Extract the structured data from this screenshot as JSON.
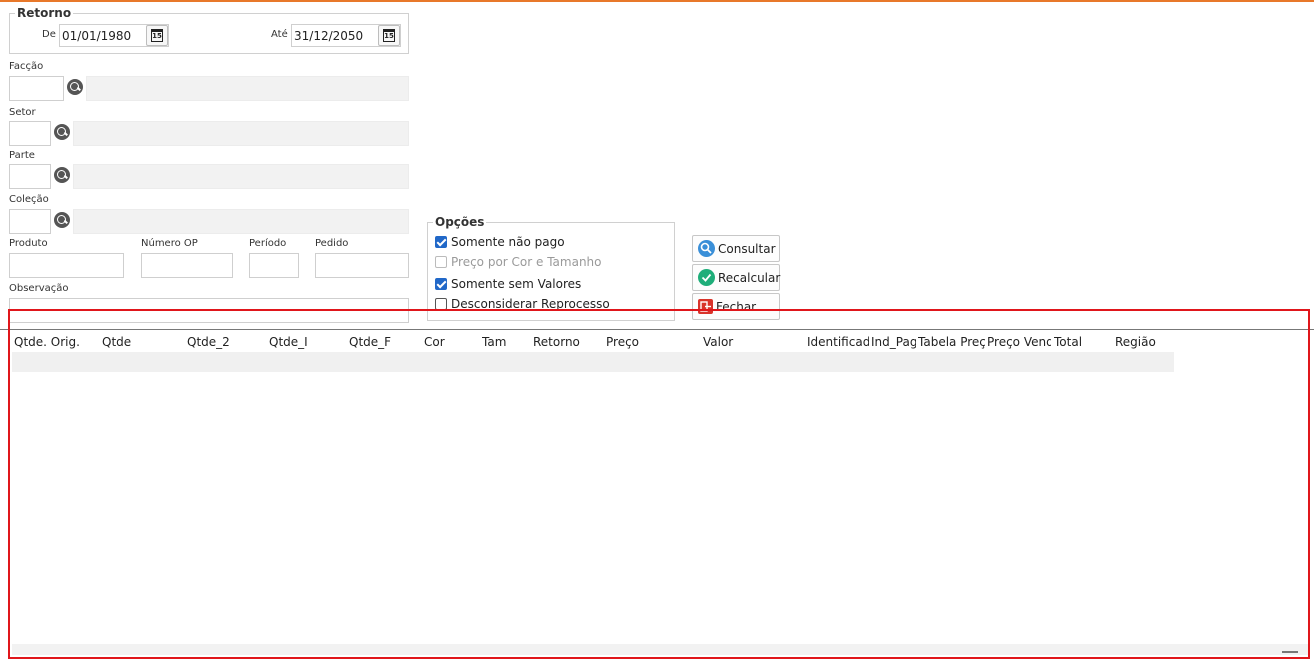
{
  "retorno": {
    "legend": "Retorno",
    "de_label": "De",
    "de_value": "01/01/1980",
    "ate_label": "Até",
    "ate_value": "31/12/2050",
    "cal_glyph": "15"
  },
  "faccao": {
    "label": "Facção"
  },
  "setor": {
    "label": "Setor"
  },
  "parte": {
    "label": "Parte"
  },
  "colecao": {
    "label": "Coleção"
  },
  "produto": {
    "label": "Produto"
  },
  "numero_op": {
    "label": "Número OP"
  },
  "periodo": {
    "label": "Período"
  },
  "pedido": {
    "label": "Pedido"
  },
  "observacao": {
    "label": "Observação"
  },
  "opcoes": {
    "legend": "Opções",
    "items": [
      {
        "label": "Somente não pago",
        "checked": true,
        "enabled": true
      },
      {
        "label": "Preço por Cor e Tamanho",
        "checked": false,
        "enabled": false
      },
      {
        "label": "Somente sem Valores",
        "checked": true,
        "enabled": true
      },
      {
        "label": "Desconsiderar Reprocesso",
        "checked": false,
        "enabled": true
      }
    ]
  },
  "buttons": {
    "consultar": "Consultar",
    "recalcular": "Recalcular",
    "fechar": "Fechar"
  },
  "grid": {
    "columns": [
      "Qtde. Orig.",
      "Qtde",
      "Qtde_2",
      "Qtde_I",
      "Qtde_F",
      "Cor",
      "Tam",
      "Retorno",
      "Preço",
      "Valor",
      "Identificador",
      "Ind_Pago",
      "Tabela Preço",
      "Preço Venda",
      "Total",
      "Região"
    ]
  },
  "colors": {
    "accent_top": "#e8782a",
    "checkbox_on": "#2168c8",
    "highlight_border": "#e0161b",
    "consultar_icon": "#3a8fd8",
    "recalcular_icon": "#1fae7a",
    "fechar_icon": "#d9342b"
  },
  "icons": {
    "search": "search-icon",
    "calendar": "calendar-icon",
    "consultar": "search-icon",
    "recalcular": "check-circle-icon",
    "fechar": "exit-icon"
  }
}
